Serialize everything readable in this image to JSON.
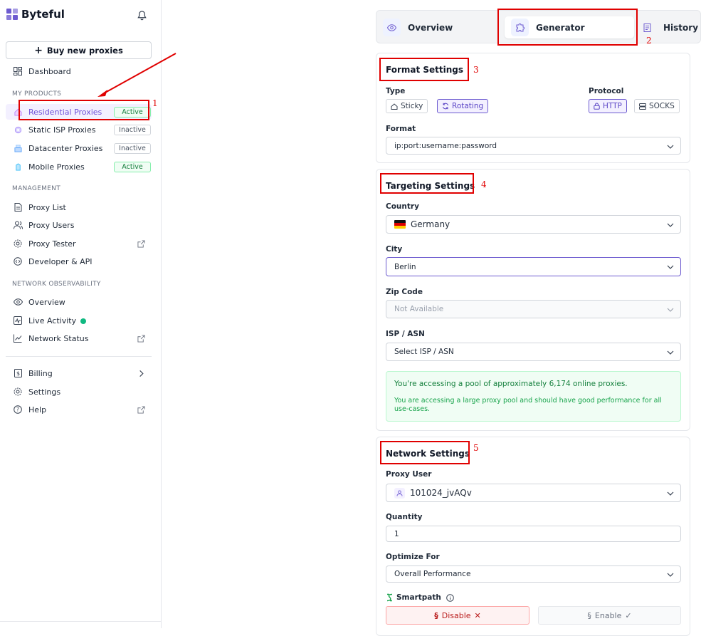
{
  "app": {
    "name": "Byteful"
  },
  "sidebar": {
    "buy_button": "Buy new proxies",
    "dashboard": "Dashboard",
    "sections": {
      "products": "MY PRODUCTS",
      "management": "MANAGEMENT",
      "observability": "NETWORK OBSERVABILITY"
    },
    "products": [
      {
        "label": "Residential Proxies",
        "status": "Active"
      },
      {
        "label": "Static ISP Proxies",
        "status": "Inactive"
      },
      {
        "label": "Datacenter Proxies",
        "status": "Inactive"
      },
      {
        "label": "Mobile Proxies",
        "status": "Active"
      }
    ],
    "management": [
      {
        "label": "Proxy List"
      },
      {
        "label": "Proxy Users"
      },
      {
        "label": "Proxy Tester"
      },
      {
        "label": "Developer & API"
      }
    ],
    "observability": [
      {
        "label": "Overview"
      },
      {
        "label": "Live Activity"
      },
      {
        "label": "Network Status"
      }
    ],
    "footer": [
      {
        "label": "Billing"
      },
      {
        "label": "Settings"
      },
      {
        "label": "Help"
      }
    ]
  },
  "tabs": [
    {
      "label": "Overview"
    },
    {
      "label": "Generator"
    },
    {
      "label": "History"
    }
  ],
  "format_settings": {
    "title": "Format Settings",
    "type_label": "Type",
    "type_options": [
      "Sticky",
      "Rotating"
    ],
    "type_selected": "Rotating",
    "protocol_label": "Protocol",
    "protocol_options": [
      "HTTP",
      "SOCKS"
    ],
    "protocol_selected": "HTTP",
    "format_label": "Format",
    "format_value": "ip:port:username:password"
  },
  "targeting_settings": {
    "title": "Targeting Settings",
    "country_label": "Country",
    "country_value": "Germany",
    "city_label": "City",
    "city_value": "Berlin",
    "zip_label": "Zip Code",
    "zip_value": "Not Available",
    "isp_label": "ISP / ASN",
    "isp_value": "Select ISP / ASN",
    "info_title": "You're accessing a pool of approximately 6,174 online proxies.",
    "info_text": "You are accessing a large proxy pool and should have good performance for all use-cases."
  },
  "network_settings": {
    "title": "Network Settings",
    "proxy_user_label": "Proxy User",
    "proxy_user_value": "101024_jvAQv",
    "quantity_label": "Quantity",
    "quantity_value": "1",
    "optimize_label": "Optimize For",
    "optimize_value": "Overall Performance",
    "smartpath_label": "Smartpath",
    "disable_label": "Disable",
    "enable_label": "Enable"
  },
  "annotations": [
    "1",
    "2",
    "3",
    "4",
    "5"
  ],
  "colors": {
    "accent": "#6d5bd0",
    "annotation": "#e00000",
    "success": "#15803d"
  }
}
